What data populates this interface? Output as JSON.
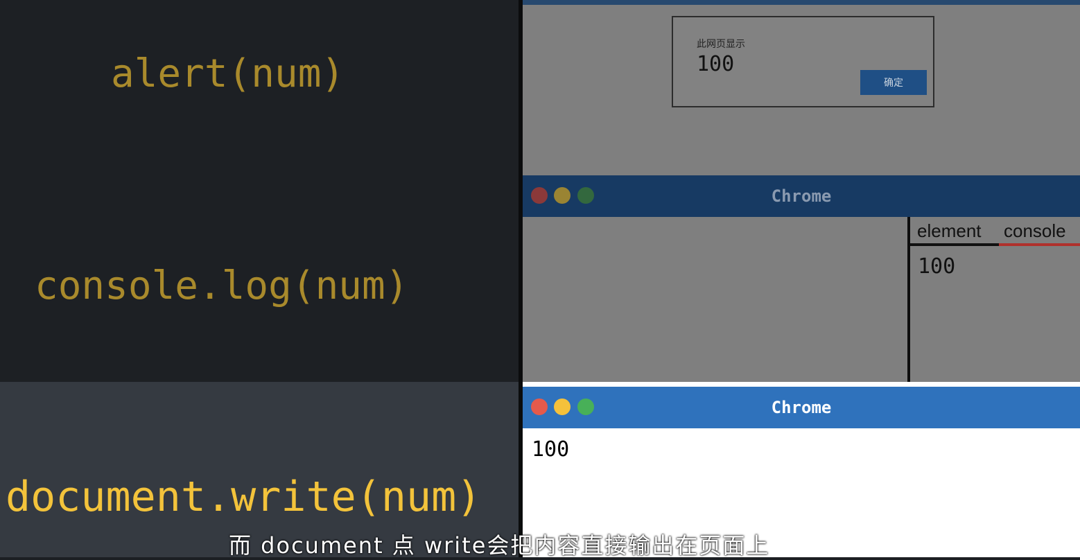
{
  "code": {
    "line1": "alert(num)",
    "line2": "console.log(num)",
    "line3": "document.write(num)"
  },
  "alert_dialog": {
    "title": "此网页显示",
    "value": "100",
    "ok_label": "确定"
  },
  "browser_devtools": {
    "title": "Chrome",
    "tabs": [
      "element",
      "console"
    ],
    "active_tab": "console",
    "console_output": "100"
  },
  "browser_page": {
    "title": "Chrome",
    "page_output": "100"
  },
  "subtitle": "而 document 点 write会把内容直接输出在页面上",
  "colors": {
    "code_text": "#f3c33b",
    "chrome_titlebar": "#2f72bc",
    "active_tab_underline": "#b0312c"
  }
}
